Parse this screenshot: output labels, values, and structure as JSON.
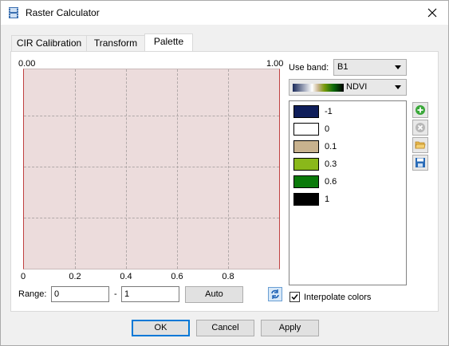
{
  "window": {
    "title": "Raster Calculator"
  },
  "tabs": [
    {
      "label": "CIR Calibration"
    },
    {
      "label": "Transform"
    },
    {
      "label": "Palette"
    }
  ],
  "graph": {
    "top_left": "0.00",
    "top_right": "1.00",
    "x_ticks": [
      "0",
      "0.2",
      "0.4",
      "0.6",
      "0.8"
    ]
  },
  "range": {
    "label": "Range:",
    "min": "0",
    "separator": "-",
    "max": "1",
    "auto_label": "Auto"
  },
  "use_band": {
    "label": "Use band:",
    "value": "B1"
  },
  "palette_select": {
    "value": "NDVI"
  },
  "palette_entries": [
    {
      "value": "-1",
      "color": "#0f1e5a"
    },
    {
      "value": "0",
      "color": "#ffffff"
    },
    {
      "value": "0.1",
      "color": "#c8b28e"
    },
    {
      "value": "0.3",
      "color": "#8ab81a"
    },
    {
      "value": "0.6",
      "color": "#0a7a0a"
    },
    {
      "value": "1",
      "color": "#000000"
    }
  ],
  "interpolate": {
    "label": "Interpolate colors",
    "checked": true
  },
  "buttons": {
    "ok": "OK",
    "cancel": "Cancel",
    "apply": "Apply"
  }
}
